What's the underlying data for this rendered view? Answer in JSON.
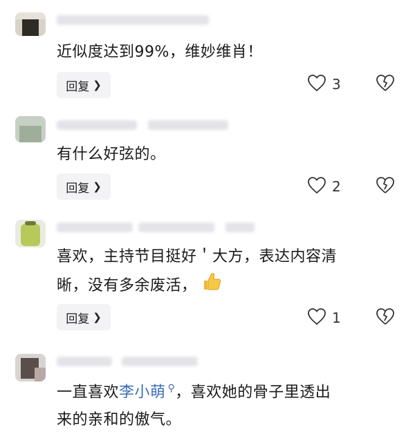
{
  "comments": [
    {
      "text": "近似度达到99%，维妙维肖！",
      "reply_label": "回复",
      "like_count": "3"
    },
    {
      "text": "有什么好弦的。",
      "reply_label": "回复",
      "like_count": "2"
    },
    {
      "text_line1": "喜欢，主持节目挺好＇大方，表达内容清",
      "text_line2": "晰，没有多余废活，",
      "emoji": "thumbs-up-emoji",
      "reply_label": "回复",
      "like_count": "1"
    },
    {
      "text_before": "一直喜欢",
      "mention": "李小萌",
      "text_after": "，喜欢她的骨子里透出",
      "text_line2": "来的亲和的傲气。"
    }
  ],
  "colors": {
    "mention": "#3d6fb6",
    "reply_bg": "#f3f3f5",
    "icon_stroke": "#333333"
  }
}
